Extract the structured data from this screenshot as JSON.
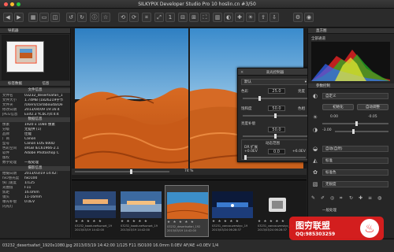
{
  "window": {
    "title": "SILKYPIX Developer Studio Pro 10 hoslin.cn  #3/50"
  },
  "left_panel": {
    "navigator_title": "导航器",
    "tags_title": "标签数据",
    "info_title": "信息",
    "file_info_heading": "文件信息",
    "file_info": [
      {
        "k": "文件名",
        "v": "03232_desertsafari_1"
      },
      {
        "k": "文件大小",
        "v": "1.74MB (1826219字节"
      },
      {
        "k": "文件夹",
        "v": "/Users/carlabouda/De"
      },
      {
        "k": "修改日期",
        "v": "2013/04/09 19:16:4"
      },
      {
        "k": "JPEG信息",
        "v": "Exif2.3 YCbCr(4:4:4"
      }
    ],
    "data_info_heading": "数据信息",
    "data_info": [
      {
        "k": "像素",
        "v": "1920 x 1080 像素"
      },
      {
        "k": "分级",
        "v": "无提供 (1)"
      },
      {
        "k": "品牌",
        "v": "佳能"
      },
      {
        "k": "厂商",
        "v": "Canon"
      },
      {
        "k": "型号",
        "v": "Canon EOS 600D"
      },
      {
        "k": "色彩空间",
        "v": "sRGB IEC61966-2.1"
      },
      {
        "k": "软件",
        "v": "Adobe Photoshop C"
      },
      {
        "k": "版权",
        "v": ""
      },
      {
        "k": "数字处理",
        "v": "一般处理"
      }
    ],
    "shooting_heading": "摄影信息",
    "shooting_info": [
      {
        "k": "拍摄日期",
        "v": "2013/03/19 14:42:"
      },
      {
        "k": "ISO感光度",
        "v": "ISO100"
      },
      {
        "k": "快门速度",
        "v": "1/125"
      },
      {
        "k": "光圈值",
        "v": "F11"
      },
      {
        "k": "焦距",
        "v": "16.0mm"
      },
      {
        "k": "镜头",
        "v": "11-16mm"
      },
      {
        "k": "曝光补偿",
        "v": "0.0EV"
      },
      {
        "k": "闪光灯",
        "v": ""
      }
    ]
  },
  "viewer": {
    "zoom": "74 %"
  },
  "highlight_panel": {
    "title": "高光控制器",
    "preset": "默认",
    "hue_label": "色彩",
    "hue_value": "25.0",
    "hue_right": "亮度",
    "sat_label": "饱和度",
    "sat_value": "50.0",
    "sat_right": "色相",
    "bright_label": "亮度补偿",
    "bright_value": "50.0",
    "dr_heading": "动态范围",
    "dr_label": "DR 扩展",
    "dr_min": "+0.0EV",
    "dr_max": "+6.0EV",
    "dr_mid": "0.0"
  },
  "filmstrip": {
    "rating": "★ ★ ★ ★ ★",
    "items": [
      {
        "name": "03232_kaadunefsunset_19",
        "date": "2013/03/19 14:42:00"
      },
      {
        "name": "03232_kaadunefsunset_19",
        "date": "2013/03/19 14:42:00"
      },
      {
        "name": "03232_desertsafari_192",
        "date": "2013/03/19 14:42:00"
      },
      {
        "name": "03231_vancouverskyc_19",
        "date": "2013/03/24 06:28:37"
      },
      {
        "name": "03231_vancouverskyc_19",
        "date": "2013/03/24 06:28:37"
      }
    ]
  },
  "right_panel": {
    "histogram_title": "直方图",
    "histogram_mode": "全部通道",
    "params_title": "参数控制",
    "wb_mode": "自定义",
    "init_button": "初始化",
    "auto_button": "自动调整",
    "exposure_value": "0.00",
    "ev_value": "-0.05",
    "offset_value": "-3.00",
    "tone_mode": "自动(自然)",
    "sharp_mode": "标准",
    "color_mode": "标准色",
    "noise_mode": "无锐度",
    "last_label": "一般处理"
  },
  "status": "03232_desertsafari_1920x1080.jpg  2013/03/19 14:42:00  1/125 F11 ISO100 16.0mm 0.0EV AF/AE  +0.0EV  1/4",
  "watermark": {
    "line1": "图穷联盟",
    "line2": "QQ:985303259"
  },
  "colors": {
    "accent": "#3b8fd8",
    "sand": "#d4641f",
    "sky": "#3c8ec8",
    "watermark": "#dc1e1e"
  }
}
